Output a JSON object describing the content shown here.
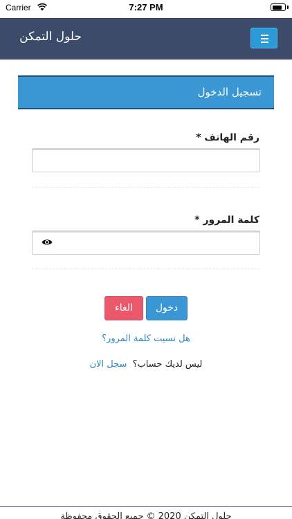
{
  "status_bar": {
    "carrier": "Carrier",
    "time": "7:27 PM",
    "battery_level": 0.85
  },
  "navbar": {
    "brand": "حلول التمكن",
    "menu_icon": "hamburger-menu-icon",
    "color": "#3d4b6b",
    "accent": "#2d9ad8"
  },
  "panel": {
    "title": "تسجيل الدخول",
    "color": "#3a97d4"
  },
  "form": {
    "phone_label": "رقم الهاتف *",
    "phone_value": "",
    "password_label": "كلمة المرور *",
    "password_value": "",
    "password_toggle_icon": "eye-icon"
  },
  "buttons": {
    "login": "دخول",
    "cancel": "الغاء",
    "login_color": "#3a97d4",
    "cancel_color": "#e9586b"
  },
  "links": {
    "forgot_password": "هل نسيت كلمة المرور؟",
    "no_account": "ليس لديك حساب؟",
    "register": "سجل الان"
  },
  "footer": {
    "text": "حلول التمكن 2020 © جميع الحقوق محفوظة"
  }
}
